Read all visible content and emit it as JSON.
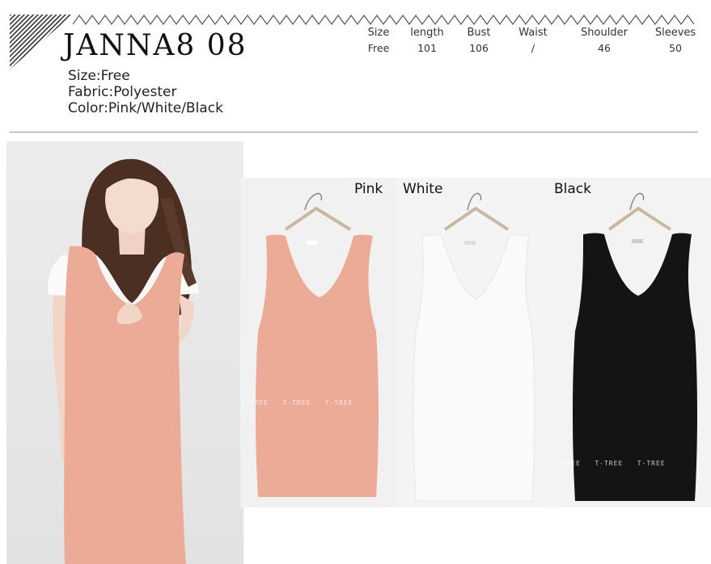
{
  "product": {
    "code": "JANNA8 08",
    "size_line": "Size:Free",
    "fabric_line": "Fabric:Polyester",
    "color_line": "Color:Pink/White/Black"
  },
  "size_table": {
    "headers": [
      "Size",
      "length",
      "Bust",
      "Waist",
      "Shoulder",
      "Sleeves"
    ],
    "values": [
      "Free",
      "101",
      "106",
      "/",
      "46",
      "50"
    ]
  },
  "colors": [
    {
      "label": "Pink",
      "hex": "#ecab96"
    },
    {
      "label": "White",
      "hex": "#fafafa"
    },
    {
      "label": "Black",
      "hex": "#141414"
    }
  ],
  "watermark": "T-TREE"
}
